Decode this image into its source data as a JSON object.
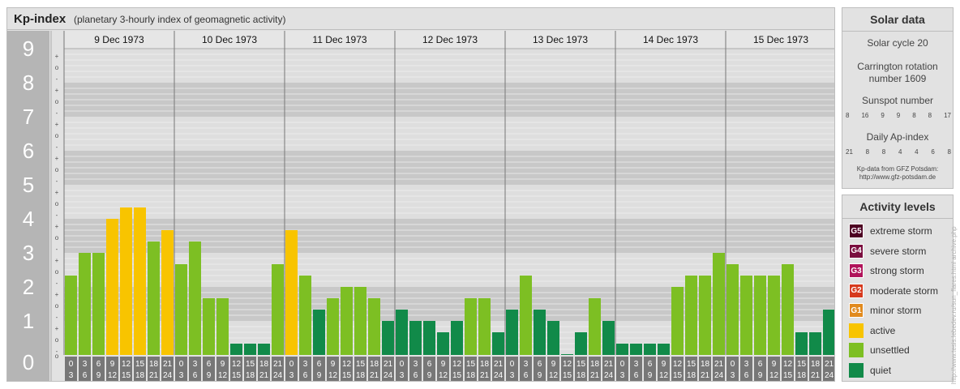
{
  "header": {
    "title": "Kp-index",
    "subtitle": "(planetary 3-hourly index of geomagnetic activity)"
  },
  "chart_data": {
    "type": "bar",
    "days": [
      "9 Dec 1973",
      "10 Dec 1973",
      "11 Dec 1973",
      "12 Dec 1973",
      "13 Dec 1973",
      "14 Dec 1973",
      "15 Dec 1973"
    ],
    "time_ticks_top": [
      "0",
      "3",
      "6",
      "9",
      "12",
      "15",
      "18",
      "21"
    ],
    "time_ticks_bottom": [
      "3",
      "6",
      "9",
      "12",
      "15",
      "18",
      "21",
      "24"
    ],
    "y_ticks": [
      "0",
      "1",
      "2",
      "3",
      "4",
      "5",
      "6",
      "7",
      "8",
      "9"
    ],
    "sub_ticks": [
      "-",
      "o",
      "+"
    ],
    "ylim": [
      0,
      9
    ],
    "values": [
      2.333,
      3.0,
      3.0,
      4.0,
      4.333,
      4.333,
      3.333,
      3.667,
      2.667,
      3.333,
      1.667,
      1.667,
      0.333,
      0.333,
      0.333,
      2.667,
      3.667,
      2.333,
      1.333,
      1.667,
      2.0,
      2.0,
      1.667,
      1.0,
      1.333,
      1.0,
      1.0,
      0.667,
      1.0,
      1.667,
      1.667,
      0.667,
      1.333,
      2.333,
      1.333,
      1.0,
      0.0,
      0.667,
      1.667,
      1.0,
      0.333,
      0.333,
      0.333,
      0.333,
      2.0,
      2.333,
      2.333,
      3.0,
      2.667,
      2.333,
      2.333,
      2.333,
      2.667,
      0.667,
      0.667,
      1.333
    ],
    "thresholds": {
      "quiet_below": 1.667,
      "active_from": 3.667
    },
    "colors": {
      "quiet": "#118a49",
      "unsettled": "#7dbf23",
      "active": "#f8c400",
      "g1": "#e18a1e",
      "g2": "#d63a1e",
      "g3": "#b0135a",
      "g4": "#7a0e3f",
      "g5": "#4d0022"
    }
  },
  "solar": {
    "title": "Solar data",
    "cycle": "Solar cycle 20",
    "carrington_label": "Carrington rotation",
    "carrington_number": "number 1609",
    "sunspot_label": "Sunspot number",
    "sunspot_values": [
      "8",
      "16",
      "9",
      "9",
      "8",
      "8",
      "17"
    ],
    "ap_label": "Daily Ap-index",
    "ap_values": [
      "21",
      "8",
      "8",
      "4",
      "4",
      "6",
      "8"
    ],
    "credit_line1": "Kp-data from GFZ Potsdam:",
    "credit_line2": "http://www.gfz-potsdam.de"
  },
  "activity": {
    "title": "Activity levels",
    "items": [
      {
        "badge": "G5",
        "label": "extreme storm",
        "color": "#4d0022"
      },
      {
        "badge": "G4",
        "label": "severe storm",
        "color": "#7a0e3f"
      },
      {
        "badge": "G3",
        "label": "strong storm",
        "color": "#b0135a"
      },
      {
        "badge": "G2",
        "label": "moderate storm",
        "color": "#d63a1e"
      },
      {
        "badge": "G1",
        "label": "minor storm",
        "color": "#e18a1e"
      },
      {
        "badge": "",
        "label": "active",
        "color": "#f8c400"
      },
      {
        "badge": "",
        "label": "unsettled",
        "color": "#7dbf23"
      },
      {
        "badge": "",
        "label": "quiet",
        "color": "#118a49"
      }
    ]
  },
  "watermark": "http://www.tesis.lebedev.ru/sun_flares.html  archive.php"
}
